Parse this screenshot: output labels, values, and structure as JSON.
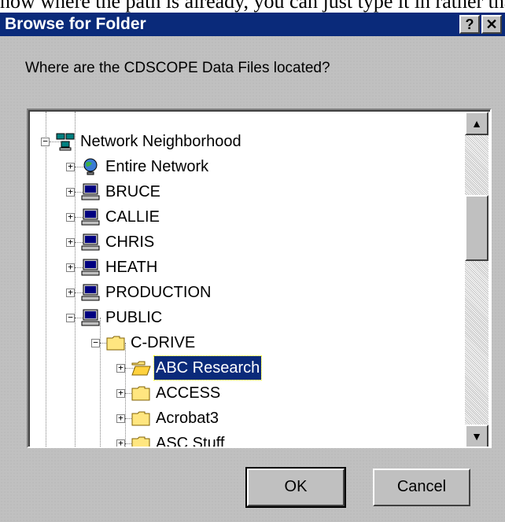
{
  "background_text": "now where the path is already, you can just type it in rather tha",
  "dialog": {
    "title": "Browse for Folder",
    "help_button": "?",
    "close_button": "✕",
    "prompt": "Where are the CDSCOPE Data Files located?",
    "tree": [
      {
        "label": "Network Neighborhood",
        "icon": "network-neighborhood-icon",
        "expander": "−",
        "level": 1
      },
      {
        "label": "Entire Network",
        "icon": "globe-icon",
        "expander": "+",
        "level": 2
      },
      {
        "label": "BRUCE",
        "icon": "computer-icon",
        "expander": "+",
        "level": 2
      },
      {
        "label": "CALLIE",
        "icon": "computer-icon",
        "expander": "+",
        "level": 2
      },
      {
        "label": "CHRIS",
        "icon": "computer-icon",
        "expander": "+",
        "level": 2
      },
      {
        "label": "HEATH",
        "icon": "computer-icon",
        "expander": "+",
        "level": 2
      },
      {
        "label": "PRODUCTION",
        "icon": "computer-icon",
        "expander": "+",
        "level": 2
      },
      {
        "label": "PUBLIC",
        "icon": "computer-icon",
        "expander": "−",
        "level": 2
      },
      {
        "label": "C-DRIVE",
        "icon": "folder-icon",
        "expander": "−",
        "level": 3
      },
      {
        "label": "ABC Research",
        "icon": "open-folder-icon",
        "expander": "+",
        "level": 4,
        "selected": true
      },
      {
        "label": "ACCESS",
        "icon": "folder-icon",
        "expander": "+",
        "level": 4
      },
      {
        "label": "Acrobat3",
        "icon": "folder-icon",
        "expander": "+",
        "level": 4
      },
      {
        "label": "ASC Stuff",
        "icon": "folder-icon",
        "expander": "+",
        "level": 4
      }
    ],
    "scroll_up": "▲",
    "scroll_down": "▼",
    "ok_label": "OK",
    "cancel_label": "Cancel"
  },
  "colors": {
    "titlebar": "#0a2a7a",
    "face": "#c0c0c0",
    "selection": "#0a2a7a"
  }
}
